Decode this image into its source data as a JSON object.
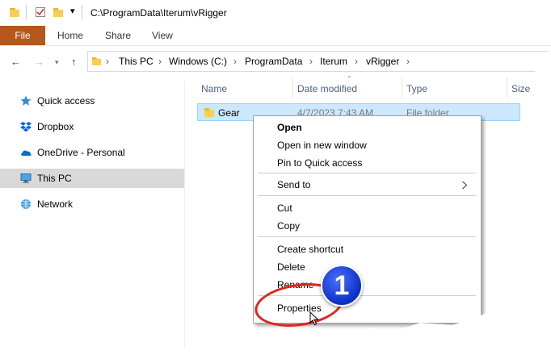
{
  "title_bar": {
    "path": "C:\\ProgramData\\Iterum\\vRigger"
  },
  "ribbon": {
    "tabs": [
      "File",
      "Home",
      "Share",
      "View"
    ]
  },
  "address_bar": {
    "crumbs": [
      "This PC",
      "Windows (C:)",
      "ProgramData",
      "Iterum",
      "vRigger"
    ]
  },
  "sidebar": {
    "items": [
      {
        "label": "Quick access",
        "icon": "star-icon"
      },
      {
        "label": "Dropbox",
        "icon": "dropbox-icon"
      },
      {
        "label": "OneDrive - Personal",
        "icon": "cloud-icon"
      },
      {
        "label": "This PC",
        "icon": "computer-icon",
        "selected": true
      },
      {
        "label": "Network",
        "icon": "network-icon"
      }
    ]
  },
  "columns": {
    "name": "Name",
    "date": "Date modified",
    "type": "Type",
    "size": "Size"
  },
  "files": [
    {
      "name": "Gear",
      "date": "4/7/2023 7:43 AM",
      "type": "File folder"
    }
  ],
  "context_menu": {
    "open": "Open",
    "open_new": "Open in new window",
    "pin": "Pin to Quick access",
    "send_to": "Send to",
    "cut": "Cut",
    "copy": "Copy",
    "shortcut": "Create shortcut",
    "delete": "Delete",
    "rename": "Rename",
    "properties": "Properties"
  },
  "callout": {
    "number": "1",
    "color": "#0a2fc4",
    "ring_color": "#e2231a"
  }
}
